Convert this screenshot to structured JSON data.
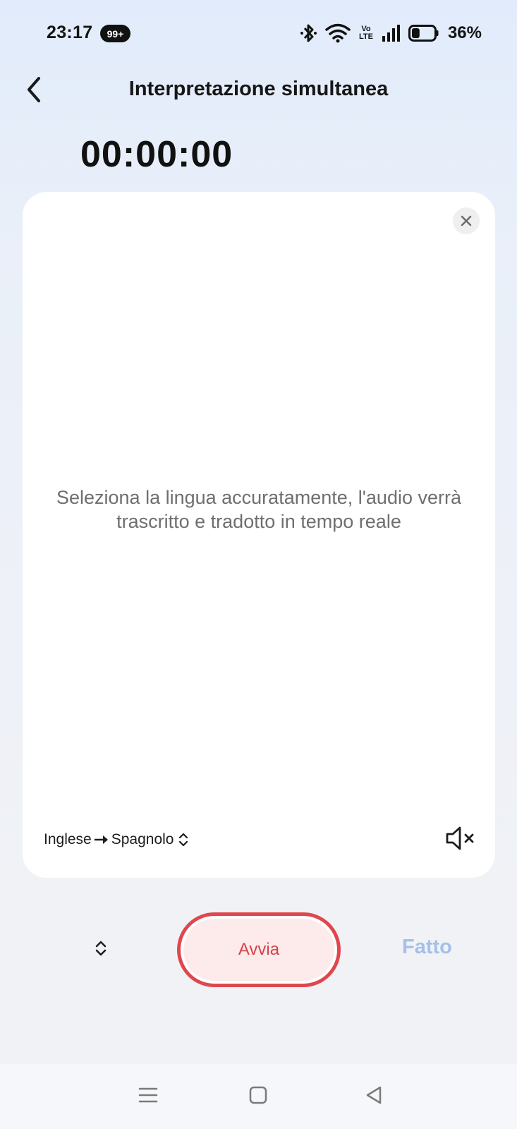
{
  "status_bar": {
    "time": "23:17",
    "notification_badge": "99+",
    "network_label_top": "Vo",
    "network_label_bottom": "LTE",
    "battery_percent": "36%",
    "battery_level": 0.36
  },
  "header": {
    "title": "Interpretazione simultanea",
    "back_icon": "chevron-left-icon"
  },
  "recording": {
    "timer": "00:00:00",
    "wave_icon": "audio-waveform-icon"
  },
  "transcript_card": {
    "hint": "Seleziona la lingua accuratamente, l'audio verrà trascritto e tradotto in tempo reale",
    "source_language": "Inglese",
    "target_language": "Spagnolo",
    "close_icon": "close-icon",
    "mute_icon": "speaker-muted-icon"
  },
  "controls": {
    "start_label": "Avvia",
    "done_label": "Fatto",
    "accent_color": "#e0474c",
    "done_color": "#a6bfe9"
  },
  "nav": {
    "menu_icon": "menu-icon",
    "home_icon": "home-square-icon",
    "back_icon": "back-triangle-icon"
  }
}
